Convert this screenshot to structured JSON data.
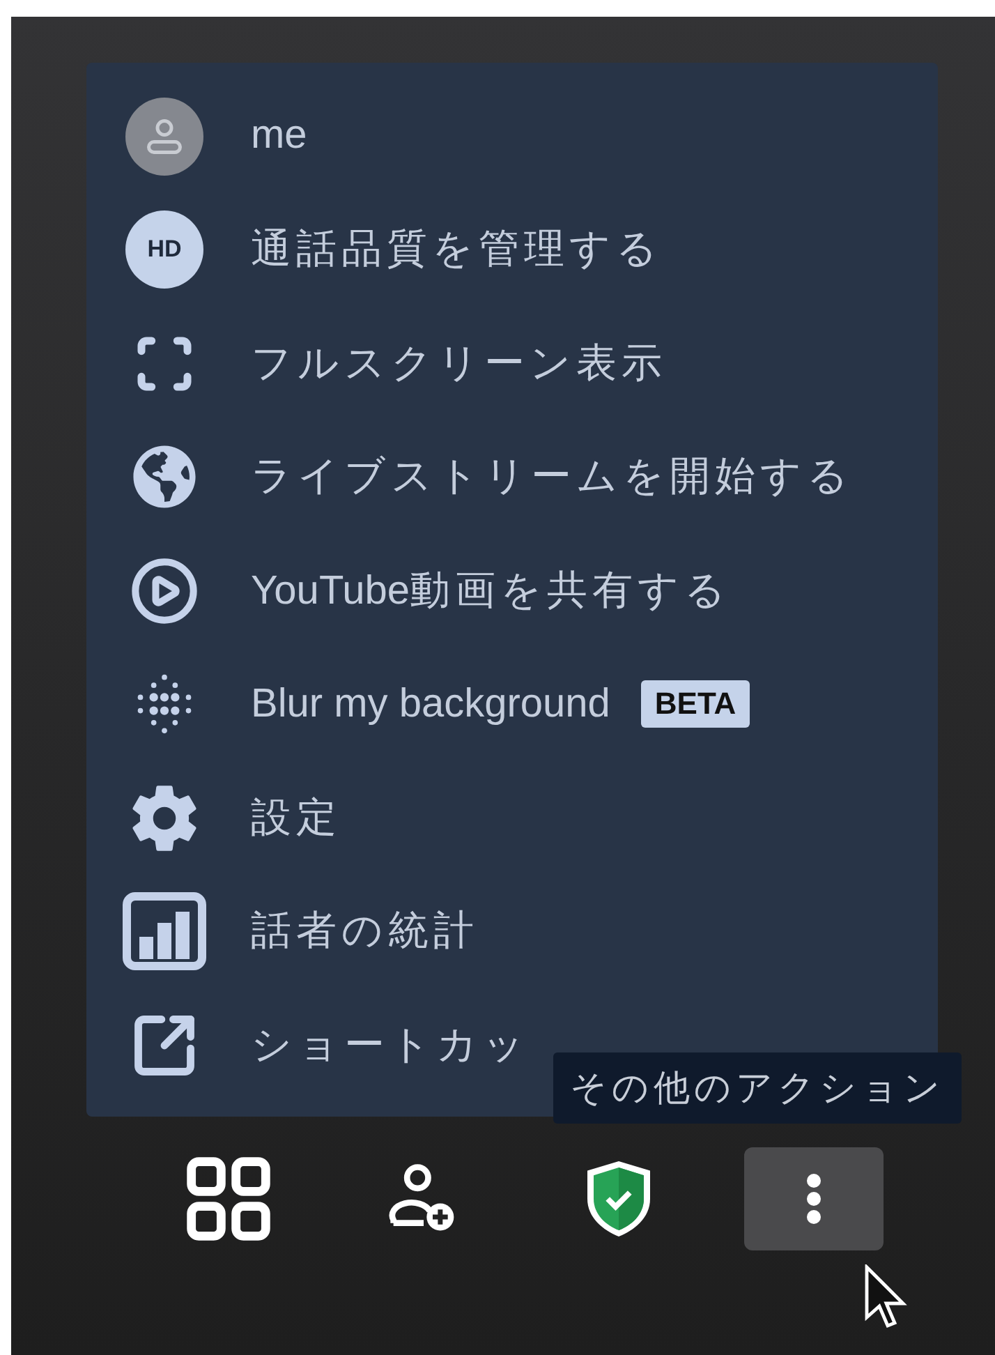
{
  "menu": {
    "items": [
      {
        "kind": "avatar",
        "label": "me"
      },
      {
        "kind": "quality",
        "label": "通話品質を管理する",
        "icon_text": "HD"
      },
      {
        "kind": "fullscreen",
        "label": "フルスクリーン表示"
      },
      {
        "kind": "livestream",
        "label": "ライブストリームを開始する"
      },
      {
        "kind": "video",
        "label": "YouTube動画を共有する"
      },
      {
        "kind": "blur",
        "label": "Blur my background",
        "badge": "BETA"
      },
      {
        "kind": "settings",
        "label": "設定"
      },
      {
        "kind": "stats",
        "label": "話者の統計"
      },
      {
        "kind": "shortcuts",
        "label": "ショートカッ"
      }
    ]
  },
  "tooltip": "その他のアクション",
  "toolbar": [
    {
      "kind": "tile-view",
      "highlighted": false
    },
    {
      "kind": "invite",
      "highlighted": false
    },
    {
      "kind": "security",
      "highlighted": false
    },
    {
      "kind": "more",
      "highlighted": true
    }
  ]
}
